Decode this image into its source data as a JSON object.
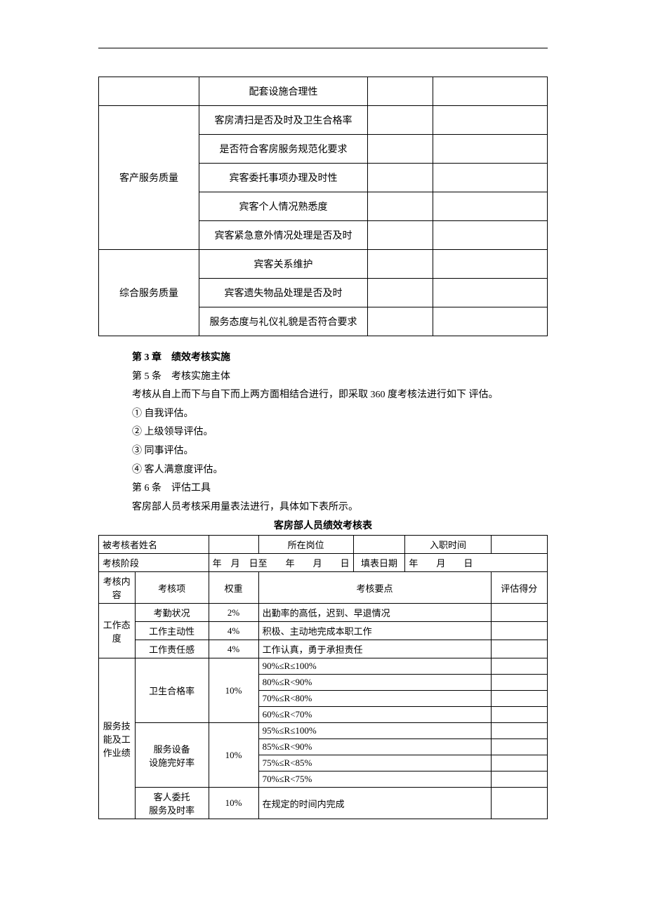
{
  "table1": {
    "row0_col2": "配套设施合理性",
    "cat1": "客产服务质量",
    "r1": "客房清扫是否及时及卫生合格率",
    "r2": "是否符合客房服务规范化要求",
    "r3": "宾客委托事项办理及时性",
    "r4": "宾客个人情况熟悉度",
    "r5": "宾客紧急意外情况处理是否及时",
    "cat2": "综合服务质量",
    "r6": "宾客关系维护",
    "r7": "宾客遗失物品处理是否及时",
    "r8": "服务态度与礼仪礼貌是否符合要求"
  },
  "text": {
    "ch_title": "第 3 章 绩效考核实施",
    "a5": "第 5 条 考核实施主体",
    "p1": "考核从自上而下与自下而上两方面相结合进行，即采取 360 度考核法进行如下 评估。",
    "li1": "① 自我评估。",
    "li2": "② 上级领导评估。",
    "li3": "③ 同事评估。",
    "li4": "④ 客人满意度评估。",
    "a6": "第 6 条 评估工具",
    "p2": "客房部人员考核采用量表法进行，具体如下表所示。",
    "t2_title": "客房部人员绩效考核表"
  },
  "table2": {
    "hdr": {
      "name": "被考核者姓名",
      "position": "所在岗位",
      "entry_time": "入职时间",
      "period": "考核阶段",
      "period_val": "年 月 日至  年  月  日",
      "fill_date": "填表日期",
      "fill_date_val": "年  月  日",
      "content": "考核内容",
      "item": "考核项",
      "weight": "权重",
      "points": "考核要点",
      "score": "评估得分"
    },
    "cat1": "工作态度",
    "cat2": "服务技能及工作业绩",
    "rows": {
      "r1": {
        "item": "考勤状况",
        "w": "2%",
        "pt": "出勤率的高低，迟到、早退情况"
      },
      "r2": {
        "item": "工作主动性",
        "w": "4%",
        "pt": "积极、主动地完成本职工作"
      },
      "r3": {
        "item": "工作责任感",
        "w": "4%",
        "pt": "工作认真，勇于承担责任"
      },
      "r4": {
        "item": "卫生合格率",
        "w": "10%"
      },
      "r4_ranges": [
        "90%≤R≤100%",
        "80%≤R<90%",
        "70%≤R<80%",
        "60%≤R<70%"
      ],
      "r5": {
        "item_l1": "服务设备",
        "item_l2": "设施完好率",
        "w": "10%"
      },
      "r5_ranges": [
        "95%≤R≤100%",
        "85%≤R<90%",
        "75%≤R<85%",
        "70%≤R<75%"
      ],
      "r6": {
        "item_l1": "客人委托",
        "item_l2": "服务及时率",
        "w": "10%",
        "pt": "在规定的时间内完成"
      }
    }
  }
}
